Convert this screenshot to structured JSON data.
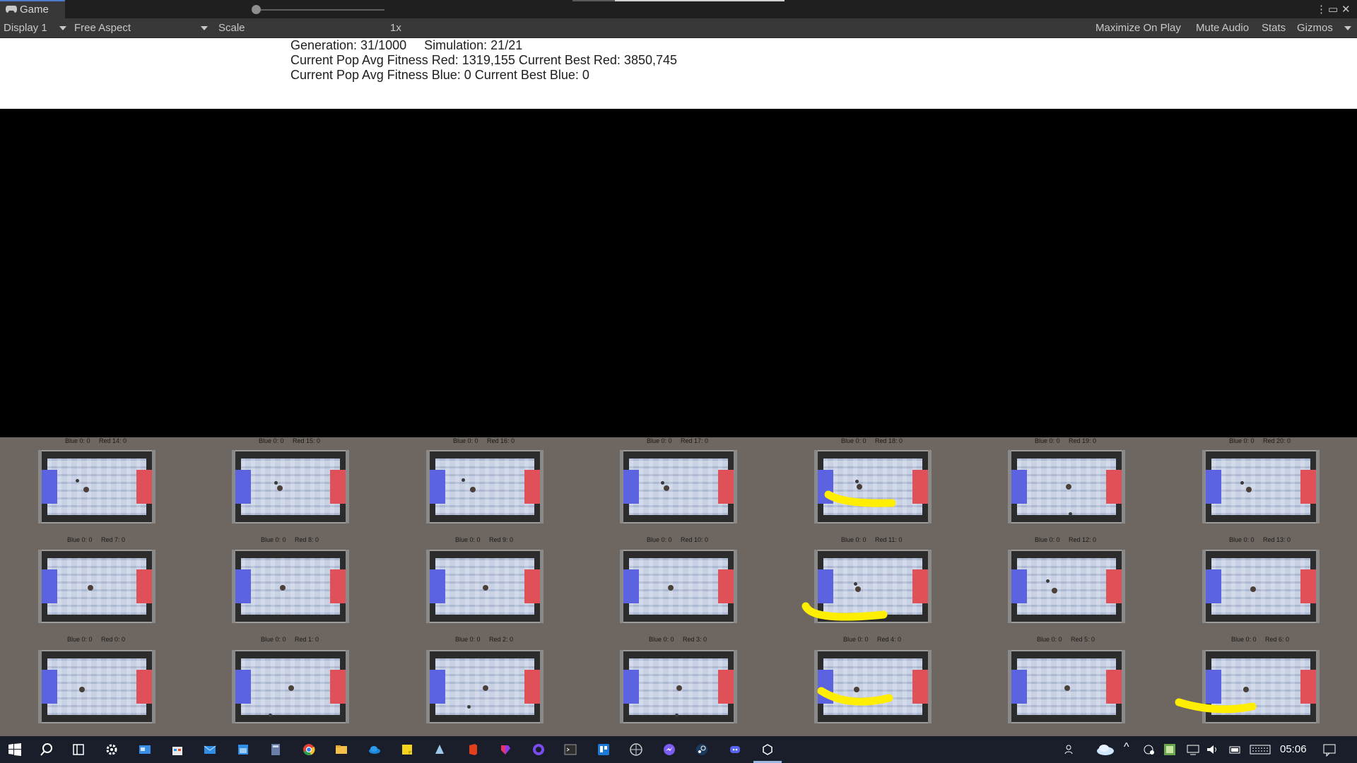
{
  "window": {
    "tab_title": "Game",
    "icons": [
      "gamepad-icon",
      "kebab-menu-icon",
      "maximize-icon",
      "close-icon"
    ]
  },
  "toolbar": {
    "display": "Display 1",
    "aspect": "Free Aspect",
    "scale_label": "Scale",
    "scale_value": "1x",
    "maximize_on_play": "Maximize On Play",
    "mute_audio": "Mute Audio",
    "stats": "Stats",
    "gizmos": "Gizmos"
  },
  "info": {
    "generation": "Generation: 31/1000     Simulation: 21/21",
    "red_line": "Current Pop Avg Fitness Red: 1319,155 Current Best Red: 3850,745",
    "blue_line": "Current Pop Avg Fitness Blue: 0 Current Best Blue: 0"
  },
  "arenas": {
    "labels": [
      "Blue 0: 0     Red 14: 0",
      "Blue 0: 0     Red 15: 0",
      "Blue 0: 0     Red 16: 0",
      "Blue 0: 0     Red 17: 0",
      "Blue 0: 0     Red 18: 0",
      "Blue 0: 0     Red 19: 0",
      "Blue 0: 0     Red 20: 0",
      "Blue 0: 0     Red 7: 0",
      "Blue 0: 0     Red 8: 0",
      "Blue 0: 0     Red 9: 0",
      "Blue 0: 0     Red 10: 0",
      "Blue 0: 0     Red 11: 0",
      "Blue 0: 0     Red 12: 0",
      "Blue 0: 0     Red 13: 0",
      "Blue 0: 0     Red 0: 0",
      "Blue 0: 0     Red 1: 0",
      "Blue 0: 0     Red 2: 0",
      "Blue 0: 0     Red 3: 0",
      "Blue 0: 0     Red 4: 0",
      "Blue 0: 0     Red 5: 0",
      "Blue 0: 0     Red 6: 0"
    ],
    "colors": {
      "blue_goal": "#5b63e0",
      "red_goal": "#e05058",
      "annotation": "#ffee00"
    }
  },
  "taskbar": {
    "icons": [
      "windows-start-icon",
      "search-icon",
      "task-view-icon",
      "settings-icon",
      "news-icon",
      "store-icon",
      "mail-icon",
      "calendar-icon",
      "calculator-icon",
      "chrome-icon",
      "file-explorer-icon",
      "onedrive-icon",
      "sticky-notes-icon",
      "app-icon",
      "office-icon",
      "app-icon-2",
      "github-icon",
      "terminal-icon",
      "trello-icon",
      "unity-hub-icon",
      "messenger-icon",
      "steam-icon",
      "discord-icon",
      "unity-icon"
    ],
    "tray_icons": [
      "people-icon",
      "cloud-icon",
      "chevron-up-icon",
      "network-icon",
      "app-tray-icon",
      "display-icon",
      "volume-icon",
      "battery-icon",
      "keyboard-icon",
      "notification-icon"
    ],
    "clock": "05:06"
  }
}
